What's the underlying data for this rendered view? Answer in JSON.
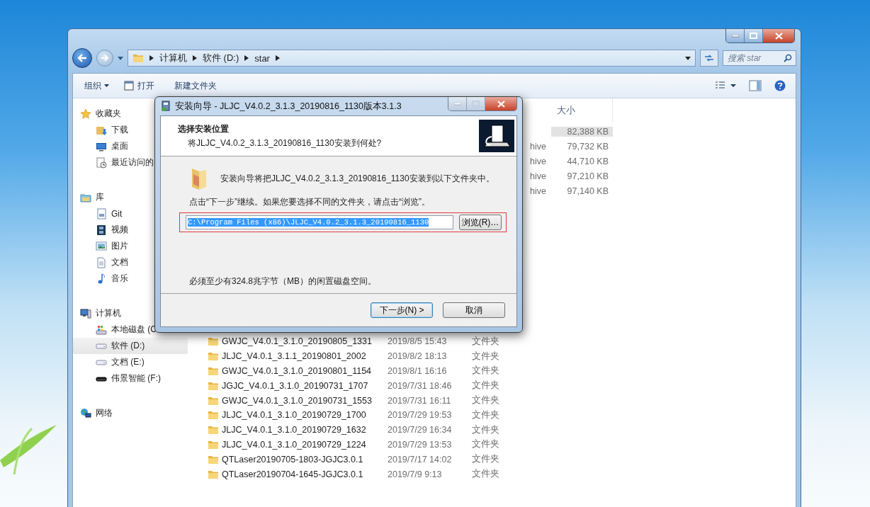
{
  "explorer": {
    "breadcrumbs": [
      "计算机",
      "软件 (D:)",
      "star"
    ],
    "search": {
      "placeholder": "搜索 star"
    },
    "toolbar": [
      {
        "label": "组织",
        "kind": "menu"
      },
      {
        "label": "打开",
        "kind": "open"
      },
      {
        "label": "新建文件夹",
        "kind": "plain"
      }
    ],
    "sidebar": [
      {
        "label": "收藏夹",
        "kind": "favorites",
        "items": [
          {
            "label": "下载",
            "kind": "download",
            "selected": false
          },
          {
            "label": "桌面",
            "kind": "desktop",
            "selected": false
          },
          {
            "label": "最近访问的",
            "kind": "recent",
            "selected": false
          }
        ]
      },
      {
        "label": "库",
        "kind": "library",
        "items": [
          {
            "label": "Git",
            "kind": "git",
            "selected": false
          },
          {
            "label": "视频",
            "kind": "video",
            "selected": false
          },
          {
            "label": "图片",
            "kind": "picture",
            "selected": false
          },
          {
            "label": "文档",
            "kind": "document",
            "selected": false
          },
          {
            "label": "音乐",
            "kind": "music",
            "selected": false
          }
        ]
      },
      {
        "label": "计算机",
        "kind": "computer",
        "items": [
          {
            "label": "本地磁盘 (C",
            "kind": "system-drive",
            "selected": false
          },
          {
            "label": "软件 (D:)",
            "kind": "drive",
            "selected": true
          },
          {
            "label": "文档 (E:)",
            "kind": "drive",
            "selected": false
          },
          {
            "label": "伟景智能 (F:)",
            "kind": "removable",
            "selected": false
          }
        ]
      },
      {
        "label": "网络",
        "kind": "network"
      }
    ],
    "file_list": {
      "columns": [
        "大小"
      ],
      "rows": [
        {
          "kind": "archive",
          "size": "82,388 KB",
          "selected": true
        },
        {
          "kind": "archive",
          "type": "hive",
          "size": "79,732 KB",
          "selected": false
        },
        {
          "kind": "archive",
          "type": "hive",
          "size": "44,710 KB",
          "selected": false
        },
        {
          "kind": "archive",
          "type": "hive",
          "size": "97,210 KB",
          "selected": false
        },
        {
          "kind": "archive",
          "type": "hive",
          "size": "97,140 KB",
          "selected": false
        },
        {
          "kind": "folder",
          "name": "GWJC_V4.0.1_3.1.0_20190805_1331",
          "date": "2019/8/5 15:43",
          "type": "文件夹",
          "selected": false
        },
        {
          "kind": "folder",
          "name": "JLJC_V4.0.1_3.1.1_20190801_2002",
          "date": "2019/8/2 18:13",
          "type": "文件夹",
          "selected": false
        },
        {
          "kind": "folder",
          "name": "GWJC_V4.0.1_3.1.0_20190801_1154",
          "date": "2019/8/1 16:16",
          "type": "文件夹",
          "selected": false
        },
        {
          "kind": "folder",
          "name": "JGJC_V4.0.1_3.1.0_20190731_1707",
          "date": "2019/7/31 18:46",
          "type": "文件夹",
          "selected": false
        },
        {
          "kind": "folder",
          "name": "GWJC_V4.0.1_3.1.0_20190731_1553",
          "date": "2019/7/31 16:11",
          "type": "文件夹",
          "selected": false
        },
        {
          "kind": "folder",
          "name": "JLJC_V4.0.1_3.1.0_20190729_1700",
          "date": "2019/7/29 19:53",
          "type": "文件夹",
          "selected": false
        },
        {
          "kind": "folder",
          "name": "JLJC_V4.0.1_3.1.0_20190729_1632",
          "date": "2019/7/29 16:34",
          "type": "文件夹",
          "selected": false
        },
        {
          "kind": "folder",
          "name": "JLJC_V4.0.1_3.1.0_20190729_1224",
          "date": "2019/7/29 13:53",
          "type": "文件夹",
          "selected": false
        },
        {
          "kind": "folder",
          "name": "QTLaser20190705-1803-JGJC3.0.1",
          "date": "2019/7/17 14:02",
          "type": "文件夹",
          "selected": false
        },
        {
          "kind": "folder",
          "name": "QTLaser20190704-1645-JGJC3.0.1",
          "date": "2019/7/9 9:13",
          "type": "文件夹",
          "selected": false
        }
      ]
    }
  },
  "dialog": {
    "title": "安装向导 - JLJC_V4.0.2_3.1.3_20190816_1130版本3.1.3",
    "heading": "选择安装位置",
    "subheading": "将JLJC_V4.0.2_3.1.3_20190816_1130安装到何处?",
    "intro": "安装向导将把JLJC_V4.0.2_3.1.3_20190816_1130安装到以下文件夹中。",
    "instruction": "点击“下一步”继续。如果您要选择不同的文件夹，请点击“浏览”。",
    "path_field": {
      "value": "C:\\Program Files (x86)\\JLJC_V4.0.2_3.1.3_20190816_1130",
      "selected": true
    },
    "browse_button": "浏览(R)…",
    "space_note": "必须至少有324.8兆字节（MB）的闲置磁盘空间。",
    "buttons": [
      {
        "label": "下一步(N) >",
        "default": true
      },
      {
        "label": "取消",
        "default": false
      }
    ]
  }
}
